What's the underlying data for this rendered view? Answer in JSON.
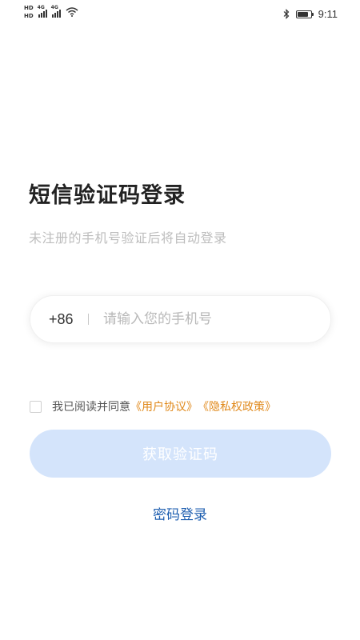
{
  "status_bar": {
    "hd1": "HD",
    "hd2": "HD",
    "net1": "4G",
    "net2": "4G",
    "time": "9:11",
    "battery_level": 0.85
  },
  "page": {
    "title": "短信验证码登录",
    "subtitle": "未注册的手机号验证后将自动登录"
  },
  "phone": {
    "country_code": "+86",
    "placeholder": "请输入您的手机号",
    "value": ""
  },
  "agreement": {
    "checked": false,
    "text": "我已阅读并同意",
    "user_agreement": "《用户协议》",
    "privacy_policy": "《隐私权政策》",
    "link_color": "#e0891b"
  },
  "actions": {
    "get_code_label": "获取验证码",
    "get_code_color": "#d4e4fb",
    "password_login_label": "密码登录",
    "password_login_color": "#1f5fb0"
  },
  "icons": [
    "hd-icon",
    "signal-icon",
    "wifi-icon",
    "bluetooth-icon",
    "battery-icon"
  ]
}
